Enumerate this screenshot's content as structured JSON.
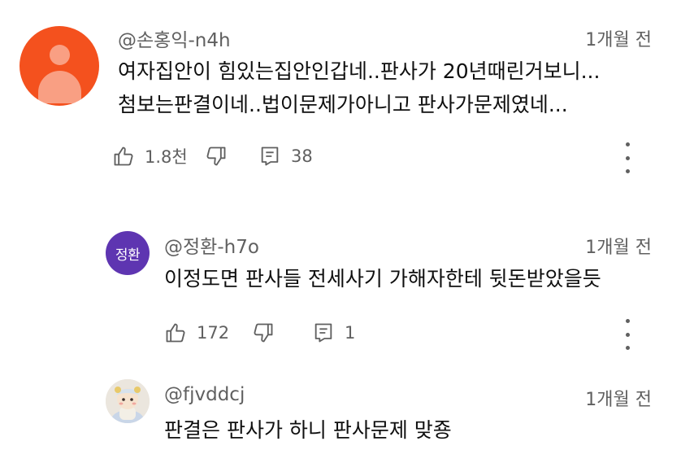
{
  "comments": [
    {
      "handle": "@손홍익-n4h",
      "time": "1개월 전",
      "lines": [
        "여자집안이 힘있는집안인갑네..판사가 20년때린거보니...",
        "첨보는판결이네..법이문제가아니고 판사가문제였네..."
      ],
      "likes": "1.8천",
      "replies": "38",
      "avatar": "default-user-avatar",
      "avatar_color": "#f4511e"
    },
    {
      "handle": "@정환-h7o",
      "time": "1개월 전",
      "avatar_text": "정환",
      "avatar_color": "#5e35b1",
      "lines": [
        "이정도면 판사들 전세사기 가해자한테 뒷돈받았을듯"
      ],
      "likes": "172",
      "replies": "1"
    },
    {
      "handle": "@fjvddcj",
      "time": "1개월 전",
      "avatar": "doll-photo-avatar",
      "lines": [
        "판결은 판사가 하니 판사문제 맞죵"
      ]
    }
  ],
  "icons": {
    "like": "thumb-up-icon",
    "dislike": "thumb-down-icon",
    "reply": "reply-comment-icon",
    "more": "more-vert-icon"
  }
}
